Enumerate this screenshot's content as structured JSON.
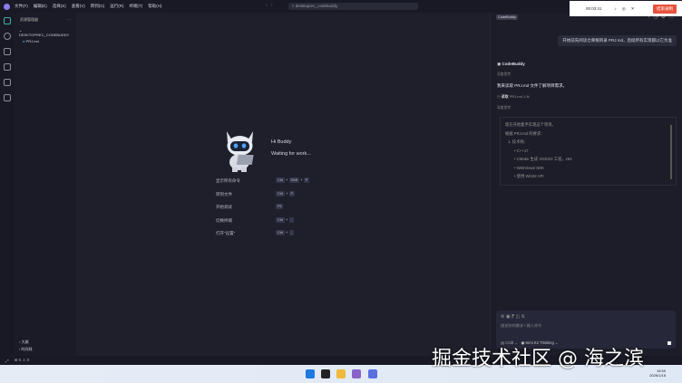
{
  "menu": [
    "文件(F)",
    "编辑(E)",
    "选择(S)",
    "查看(V)",
    "转到(G)",
    "运行(R)",
    "终端(T)",
    "帮助(H)"
  ],
  "search": "desktoprec_codebuddy",
  "explorer": {
    "title": "资源管理器",
    "more": "···",
    "folder": "DESKTOPREC_CODEBUDDY",
    "file": "PRJ.md",
    "outline": "大纲",
    "timeline": "时间线"
  },
  "welcome": {
    "greet": "Hi Buddy",
    "status": "Waiting for work...",
    "shortcuts": [
      {
        "label": "显示所有命令",
        "keys": [
          "Ctrl",
          "Shift",
          "P"
        ]
      },
      {
        "label": "转到文件",
        "keys": [
          "Ctrl",
          "P"
        ]
      },
      {
        "label": "开始调试",
        "keys": [
          "F5"
        ]
      },
      {
        "label": "切换终端",
        "keys": [
          "Ctrl",
          "`"
        ]
      },
      {
        "label": "打开\"设置\"",
        "keys": [
          "Ctrl",
          ","
        ]
      }
    ]
  },
  "chat": {
    "badge": "CodeBuddy",
    "user_msg": "开始前先阅读仓库根目录 PRJ.md，后续所有实现都以它为准",
    "bot": "CodeBuddy",
    "think1": "深度思考",
    "reply": "我来读取 PRJ.md 文件了解项目需求。",
    "read": "读取",
    "read_file": "PRJ.md 1-N",
    "think2": "深度思考",
    "think_lines": [
      "现在开始着手实现这个项目。",
      "根据 PRJ.md 的要求：",
      "1. 技术栈：",
      "C++17",
      "CMake 生成 VS2022 工程，x64",
      "WebView2 SDK",
      "使用 Win32 API"
    ],
    "placeholder": "描述你的需求 / 输入命令",
    "mode": "Craft",
    "model": "Kimi K2 Thinking"
  },
  "status": {
    "errors": "0",
    "warnings": "0"
  },
  "recorder": {
    "time": "00:03:41",
    "stop": "结束录制"
  },
  "clock": {
    "time": "16:59",
    "date": "2026/1/18"
  },
  "watermark": "掘金技术社区 @ 海之滨"
}
